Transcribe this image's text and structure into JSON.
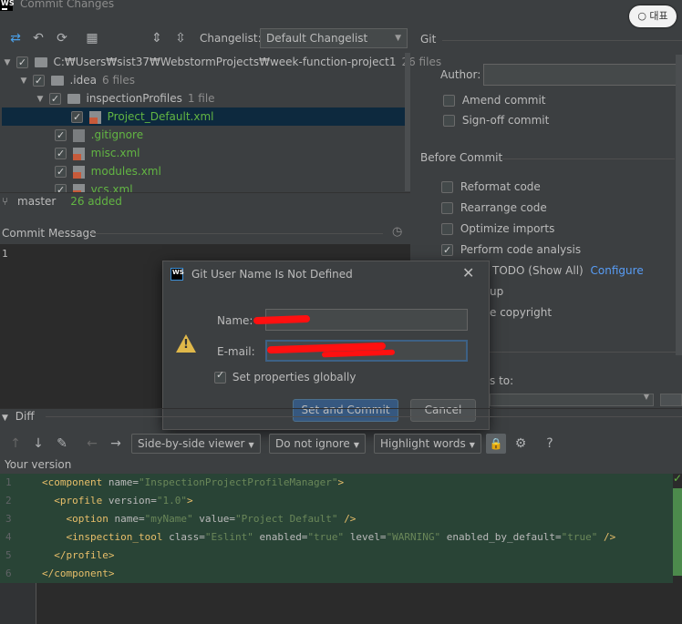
{
  "window": {
    "title": "Commit Changes",
    "logo_text": "WS",
    "pill_button": "○ 대표"
  },
  "toolbar": {
    "changelist_label": "Changelist:",
    "changelist_value": "Default Changelist"
  },
  "tree": {
    "root": {
      "label": "C:₩Users₩sist37₩WebstormProjects₩week-function-project1",
      "count": "26 files"
    },
    "idea": {
      "label": ".idea",
      "count": "6 files"
    },
    "inspection": {
      "label": "inspectionProfiles",
      "count": "1 file"
    },
    "files": [
      "Project_Default.xml",
      ".gitignore",
      "misc.xml",
      "modules.xml",
      "vcs.xml"
    ]
  },
  "status": {
    "branch": "master",
    "added": "26 added"
  },
  "commit": {
    "label": "Commit Message",
    "line1": "1"
  },
  "git_panel": {
    "title": "Git",
    "author_label": "Author:",
    "amend": "Amend commit",
    "signoff": "Sign-off commit",
    "before_commit": "Before Commit",
    "reformat": "Reformat code",
    "rearrange": "Rearrange code",
    "optimize": "Optimize imports",
    "analysis": "Perform code analysis",
    "todo": "TODO (Show All)",
    "configure": "Configure",
    "cleanup": "up",
    "copyright": "e copyright",
    "changes_to": "s to:"
  },
  "dialog": {
    "logo_text": "WS",
    "title": "Git User Name Is Not Defined",
    "name_label": "Name:",
    "email_label": "E-mail:",
    "set_globally": "Set properties globally",
    "primary": "Set and Commit",
    "cancel": "Cancel"
  },
  "diff": {
    "title": "Diff",
    "viewer": "Side-by-side viewer",
    "ignore": "Do not ignore",
    "highlight": "Highlight words",
    "help": "?",
    "your_version": "Your version",
    "line_numbers": [
      "1",
      "2",
      "3",
      "4",
      "5",
      "6"
    ]
  }
}
